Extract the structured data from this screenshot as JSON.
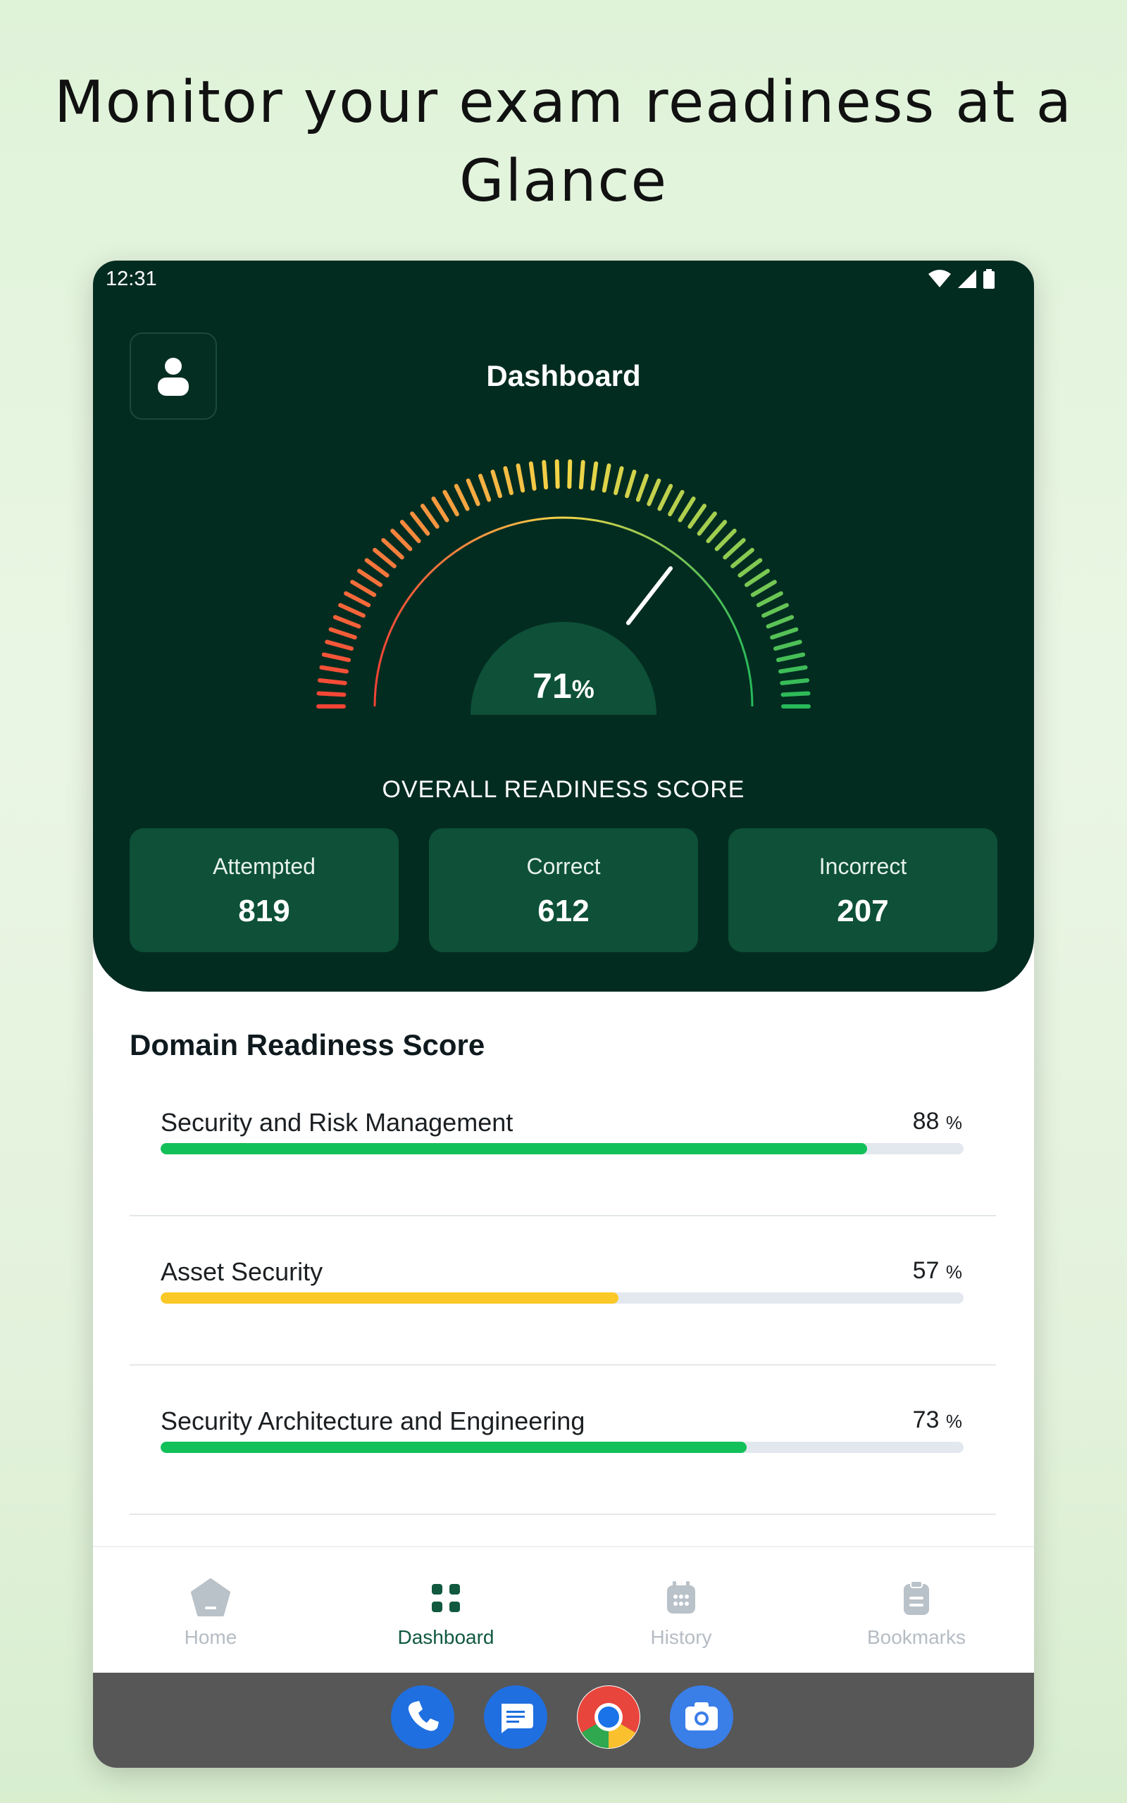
{
  "headline": "Monitor your exam readiness at a Glance",
  "status_bar": {
    "time": "12:31"
  },
  "header": {
    "title": "Dashboard"
  },
  "gauge": {
    "value": "71",
    "unit": "%",
    "label": "OVERALL READINESS SCORE",
    "fraction": 0.71
  },
  "stats": [
    {
      "label": "Attempted",
      "value": "819"
    },
    {
      "label": "Correct",
      "value": "612"
    },
    {
      "label": "Incorrect",
      "value": "207"
    }
  ],
  "domain_section": {
    "title": "Domain Readiness Score",
    "items": [
      {
        "name": "Security and Risk Management",
        "value": "88",
        "unit": "%",
        "fraction": 0.88,
        "color": "#12c05a"
      },
      {
        "name": "Asset Security",
        "value": "57",
        "unit": "%",
        "fraction": 0.57,
        "color": "#fbc927"
      },
      {
        "name": "Security Architecture and Engineering",
        "value": "73",
        "unit": "%",
        "fraction": 0.73,
        "color": "#12c05a"
      }
    ]
  },
  "bottom_nav": [
    {
      "label": "Home",
      "icon": "home-pentagon-icon",
      "active": false
    },
    {
      "label": "Dashboard",
      "icon": "grid-icon",
      "active": true
    },
    {
      "label": "History",
      "icon": "calendar-icon",
      "active": false
    },
    {
      "label": "Bookmarks",
      "icon": "clipboard-icon",
      "active": false
    }
  ],
  "dock": [
    {
      "icon": "phone-icon",
      "color": "#1f6fe0"
    },
    {
      "icon": "messages-icon",
      "color": "#1f6fe0"
    },
    {
      "icon": "chrome-icon",
      "color": "#e8453c"
    },
    {
      "icon": "camera-icon",
      "color": "#3a7ee8"
    }
  ],
  "colors": {
    "hero": "#032c20",
    "stat_card": "#0e5038",
    "accent": "#10593f"
  }
}
